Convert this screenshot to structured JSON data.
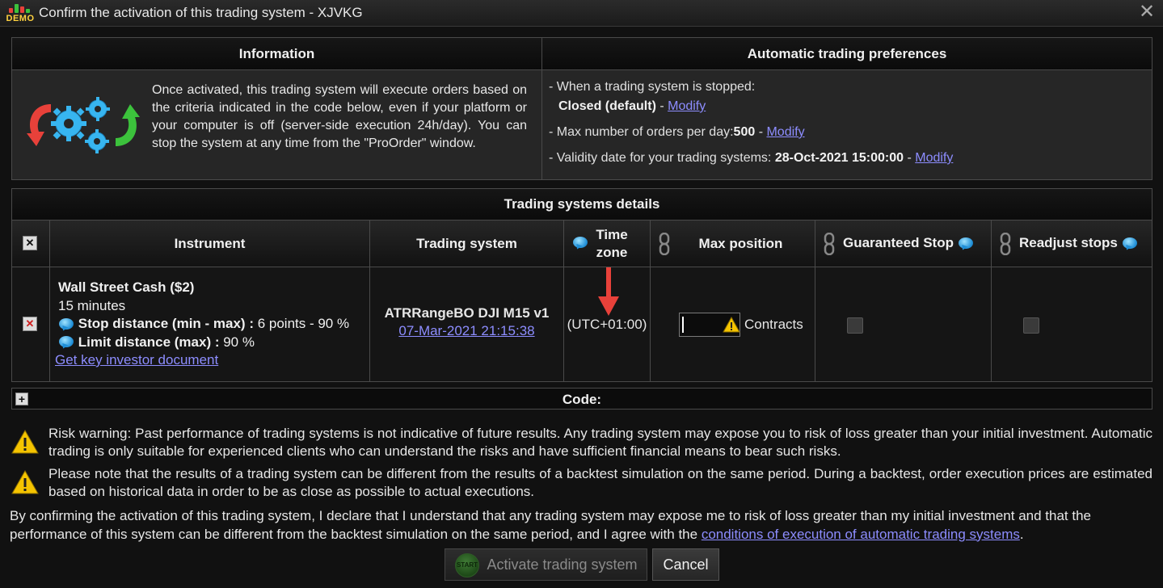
{
  "window": {
    "badge": "DEMO",
    "title": "Confirm the activation of this trading system - XJVKG",
    "close_glyph": "✕"
  },
  "information": {
    "header": "Information",
    "text": "Once activated, this trading system will execute orders based on the criteria indicated in the code below, even if your platform or your computer is off (server-side execution 24h/day). You can stop the system at any time from the \"ProOrder\" window.",
    "icon": "gears-arrows-icon"
  },
  "preferences": {
    "header": "Automatic trading preferences",
    "stopped_label": "- When a trading system is stopped:",
    "stopped_value": "Closed (default)",
    "sep": " - ",
    "modify": "Modify",
    "max_orders_label": "- Max number of orders per day:",
    "max_orders_value": "500",
    "validity_label": "- Validity date for your trading systems: ",
    "validity_value": "28-Oct-2021 15:00:00"
  },
  "details": {
    "header": "Trading systems details",
    "columns": {
      "instrument": "Instrument",
      "trading_system": "Trading system",
      "time_zone": "Time zone",
      "max_position": "Max position",
      "guaranteed_stop": "Guaranteed Stop",
      "readjust_stops": "Readjust stops"
    },
    "row": {
      "instrument_name": "Wall Street Cash ($2)",
      "timeframe": "15 minutes",
      "stop_label": "Stop distance (min - max) :",
      "stop_value": " 6 points - 90 %",
      "limit_label": "Limit distance (max) :",
      "limit_value": " 90 %",
      "kid_link": "Get key investor document",
      "system_name": "ATRRangeBO DJI M15 v1",
      "system_date": "07-Mar-2021 21:15:38",
      "time_zone": "(UTC+01:00)",
      "max_position_value": "",
      "contracts_label": "Contracts",
      "guaranteed_stop_checked": false,
      "readjust_stops_checked": false
    }
  },
  "code": {
    "label": "Code:"
  },
  "warnings": [
    "Risk warning: Past performance of trading systems is not indicative of future results. Any trading system may expose you to risk of loss greater than your initial investment. Automatic trading is only suitable for experienced clients who can understand the risks and have sufficient financial means to bear such risks.",
    "Please note that the results of a trading system can be different from the results of a backtest simulation on the same period. During a backtest, order execution prices are estimated based on historical data in order to be as close as possible to actual executions."
  ],
  "declaration": {
    "text": "By confirming the activation of this trading system, I declare that I understand that any trading system may expose me to risk of loss greater than my initial investment and that the performance of this system can be different from the backtest simulation on the same period, and I agree with the ",
    "link": "conditions of execution of automatic trading systems",
    "end": "."
  },
  "buttons": {
    "start_badge": "START",
    "activate": "Activate trading system",
    "cancel": "Cancel"
  },
  "colors": {
    "link": "#8d8dff",
    "warning_yellow": "#f5c400",
    "arrow_red": "#e8413a",
    "arrow_green": "#3cc23c",
    "gear_blue": "#37b5f0"
  }
}
